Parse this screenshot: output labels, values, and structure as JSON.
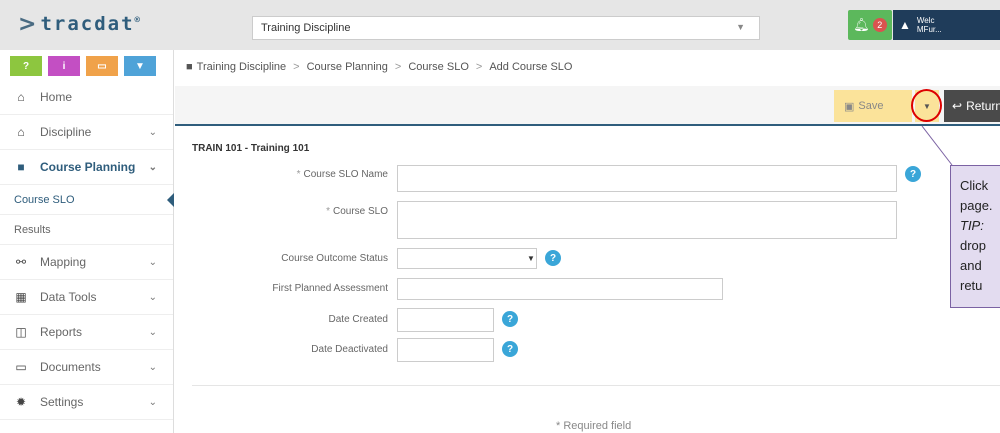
{
  "app": {
    "logo_text": "tracdat",
    "logo_mark": ">",
    "logo_tm": "®"
  },
  "header": {
    "discipline_select": "Training Discipline",
    "notification_count": "2",
    "user_line1": "Welc",
    "user_line2": "MFur..."
  },
  "quick_buttons": [
    {
      "glyph": "?",
      "color": "#8dc63f",
      "icon": "help-icon"
    },
    {
      "glyph": "i",
      "color": "#c34fc3",
      "icon": "info-icon"
    },
    {
      "glyph": "▭",
      "color": "#f0a24a",
      "icon": "window-icon"
    },
    {
      "glyph": "▼",
      "color": "#4fa3d8",
      "icon": "filter-icon"
    }
  ],
  "sidebar": {
    "items": [
      {
        "label": "Home",
        "icon": "⌂"
      },
      {
        "label": "Discipline",
        "icon": "⌂",
        "chevron": "⌄"
      },
      {
        "label": "Course Planning",
        "icon": "■",
        "chevron": "⌄"
      },
      {
        "label": "Course SLO"
      },
      {
        "label": "Results"
      },
      {
        "label": "Mapping",
        "icon": "⚯",
        "chevron": "⌄"
      },
      {
        "label": "Data Tools",
        "icon": "▦",
        "chevron": "⌄"
      },
      {
        "label": "Reports",
        "icon": "◫",
        "chevron": "⌄"
      },
      {
        "label": "Documents",
        "icon": "▭",
        "chevron": "⌄"
      },
      {
        "label": "Settings",
        "icon": "✹",
        "chevron": "⌄"
      }
    ]
  },
  "breadcrumb": [
    "Training Discipline",
    "Course Planning",
    "Course SLO",
    "Add Course SLO"
  ],
  "breadcrumb_sep": ">",
  "toolbar": {
    "save_label": "Save",
    "return_label": "Return"
  },
  "form": {
    "course_title": "TRAIN 101 - Training 101",
    "required_marker": "*",
    "labels": {
      "slo_name": "Course SLO Name",
      "slo": "Course SLO",
      "status": "Course Outcome Status",
      "first_assessment": "First Planned Assessment",
      "date_created": "Date Created",
      "date_deactivated": "Date Deactivated"
    },
    "values": {
      "slo_name": "",
      "slo": "",
      "status": "",
      "first_assessment": "",
      "date_created": "",
      "date_deactivated": ""
    },
    "required_note": "Required field"
  },
  "callout": {
    "line1": "Click",
    "line2": "page.",
    "line3": "TIP:",
    "line4": "drop",
    "line5": "and",
    "line6": "retu"
  },
  "colors": {
    "brand": "#2f5d7c",
    "save": "#fbe39a",
    "help": "#3aa6d8",
    "callout_bg": "#e3dcf0",
    "callout_border": "#7b62a3"
  }
}
